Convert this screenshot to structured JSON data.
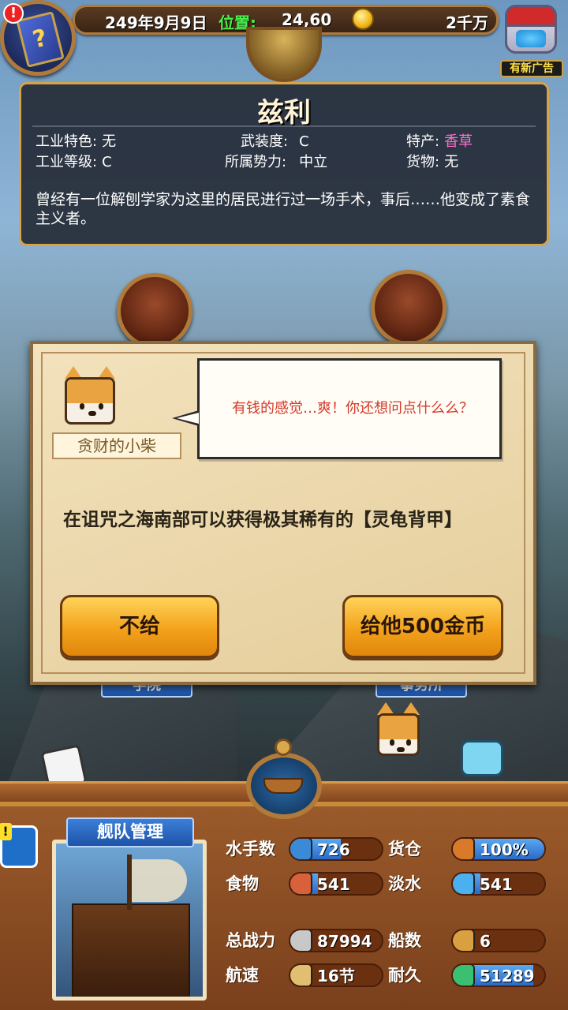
{
  "topbar": {
    "date": "249年9月9日",
    "position_label": "位置:",
    "position_value": "24,60",
    "gold": "2千万",
    "alert_icon": "!"
  },
  "ad_chest": {
    "label": "有新广告"
  },
  "city": {
    "name": "兹利",
    "stats": [
      {
        "label": "工业特色:",
        "value": "无"
      },
      {
        "label": "武装度:",
        "value": "C"
      },
      {
        "label": "特产:",
        "value": "香草"
      },
      {
        "label": "工业等级:",
        "value": "C"
      },
      {
        "label": "所属势力:",
        "value": "中立"
      },
      {
        "label": "货物:",
        "value": "无"
      }
    ],
    "description": "曾经有一位解刨学家为这里的居民进行过一场手术，事后……他变成了素食主义者。"
  },
  "buildings": [
    {
      "ribbon": "学院"
    },
    {
      "ribbon": "事务所"
    }
  ],
  "dialog": {
    "npc_name": "贪财的小柴",
    "speech": "有钱的感觉…爽！你还想问点什么么？",
    "question": "在诅咒之海南部可以获得极其稀有的【灵龟背甲】",
    "decline_button": "不给",
    "accept_button": "给他500金币"
  },
  "fleet": {
    "title": "舰队管理",
    "badge_alert": "!",
    "stats": [
      {
        "label": "水手数",
        "value": "726",
        "icon": "sailor-icon",
        "fill": 0.55
      },
      {
        "label": "货仓",
        "value": "100%",
        "icon": "cargo-icon",
        "fill": 1.0
      },
      {
        "label": "食物",
        "value": "541",
        "icon": "meat-icon",
        "fill": 0.3
      },
      {
        "label": "淡水",
        "value": "541",
        "icon": "water-icon",
        "fill": 0.3
      },
      {
        "label": "总战力",
        "value": "87994",
        "icon": "sword-icon",
        "fill": 0
      },
      {
        "label": "船数",
        "value": "6",
        "icon": "boat-icon",
        "fill": 0
      },
      {
        "label": "航速",
        "value": "16节",
        "icon": "speed-icon",
        "fill": 0
      },
      {
        "label": "耐久",
        "value": "51289",
        "icon": "durability-icon",
        "fill": 0.88
      }
    ]
  }
}
